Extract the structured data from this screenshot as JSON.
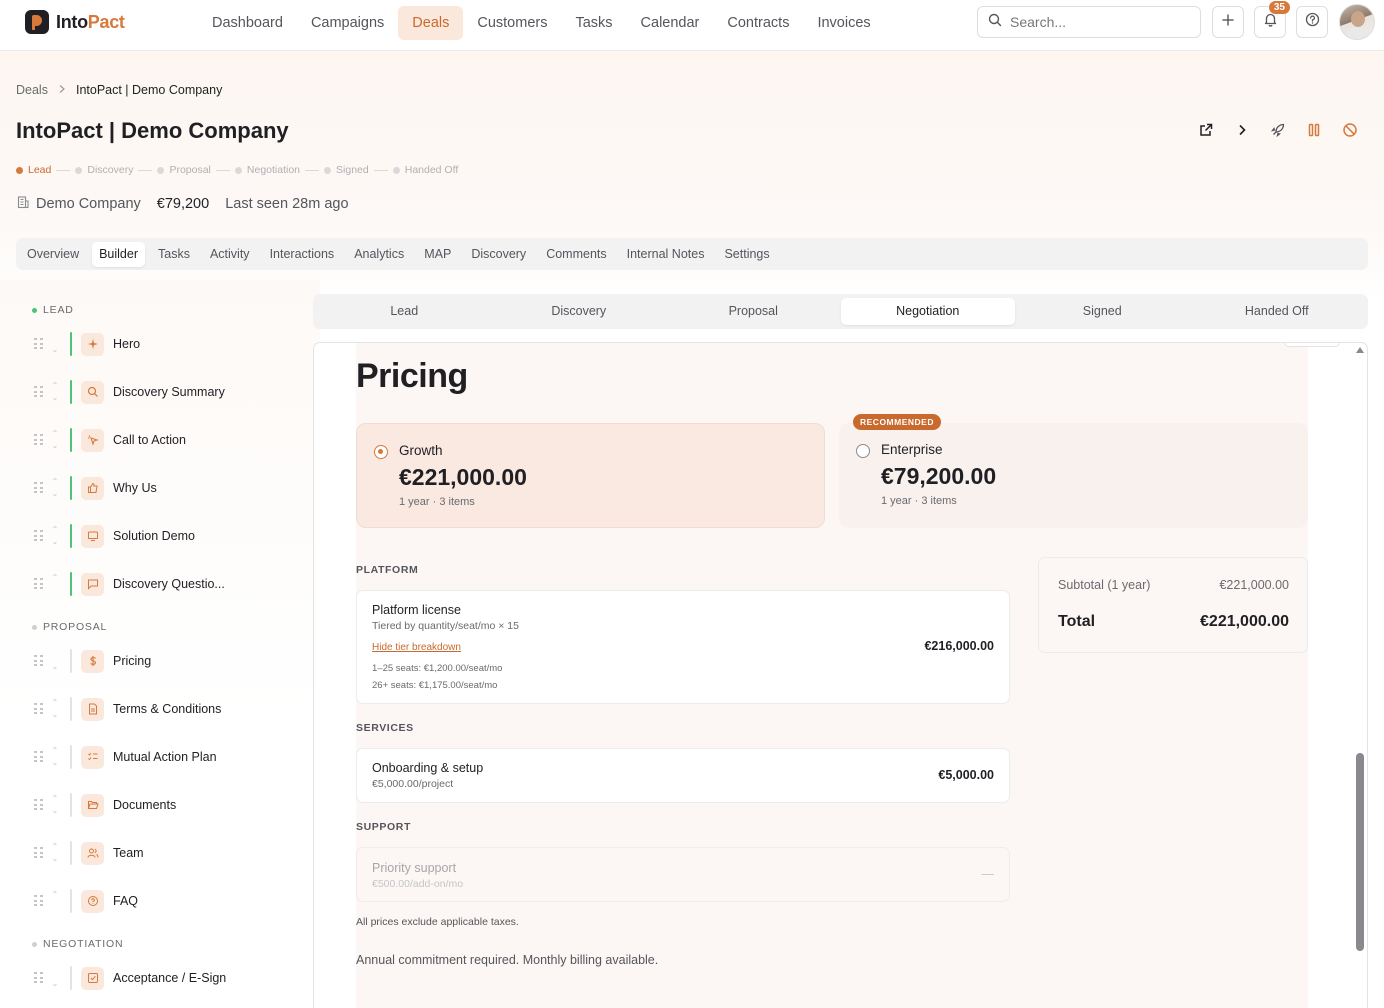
{
  "app": {
    "logo_main": "Into",
    "logo_accent": "Pact",
    "nav": [
      "Dashboard",
      "Campaigns",
      "Deals",
      "Customers",
      "Tasks",
      "Calendar",
      "Contracts",
      "Invoices"
    ],
    "active_nav": "Deals",
    "search_placeholder": "Search...",
    "notification_count": "35",
    "accent_color": "#d6793b"
  },
  "breadcrumb": [
    "Deals",
    "IntoPact | Demo Company"
  ],
  "deal": {
    "title": "IntoPact | Demo Company",
    "company": "Demo Company",
    "amount": "€79,200",
    "last_seen": "Last seen 28m ago",
    "stages": [
      "Lead",
      "Discovery",
      "Proposal",
      "Negotiation",
      "Signed",
      "Handed Off"
    ],
    "current_stage": "Lead"
  },
  "header_actions": [
    "external-link-icon",
    "chevron-right-icon",
    "rocket-icon",
    "pause-icon",
    "ban-icon"
  ],
  "tabs": [
    "Overview",
    "Builder",
    "Tasks",
    "Activity",
    "Interactions",
    "Analytics",
    "MAP",
    "Discovery",
    "Comments",
    "Internal Notes",
    "Settings"
  ],
  "active_tab": "Builder",
  "sidebar": {
    "sections": [
      {
        "label": "LEAD",
        "blocks": [
          {
            "label": "Hero",
            "icon": "sparkle-icon"
          },
          {
            "label": "Discovery Summary",
            "icon": "search-icon"
          },
          {
            "label": "Call to Action",
            "icon": "cursor-click-icon"
          },
          {
            "label": "Why Us",
            "icon": "thumbs-up-icon"
          },
          {
            "label": "Solution Demo",
            "icon": "monitor-icon"
          },
          {
            "label": "Discovery Questio...",
            "icon": "message-square-icon"
          }
        ]
      },
      {
        "label": "PROPOSAL",
        "blocks": [
          {
            "label": "Pricing",
            "icon": "dollar-icon"
          },
          {
            "label": "Terms & Conditions",
            "icon": "file-text-icon"
          },
          {
            "label": "Mutual Action Plan",
            "icon": "list-checks-icon"
          },
          {
            "label": "Documents",
            "icon": "folder-open-icon"
          },
          {
            "label": "Team",
            "icon": "users-icon"
          },
          {
            "label": "FAQ",
            "icon": "help-circle-icon"
          }
        ]
      },
      {
        "label": "NEGOTIATION",
        "blocks": [
          {
            "label": "Acceptance / E-Sign",
            "icon": "check-square-icon"
          }
        ]
      }
    ]
  },
  "stage_tabs": [
    "Lead",
    "Discovery",
    "Proposal",
    "Negotiation",
    "Signed",
    "Handed Off"
  ],
  "active_stage_tab": "Negotiation",
  "pricing": {
    "title": "Pricing",
    "plans": [
      {
        "name": "Growth",
        "price": "€221,000.00",
        "sub": "1 year · 3 items",
        "selected": true
      },
      {
        "name": "Enterprise",
        "price": "€79,200.00",
        "sub": "1 year · 3 items",
        "selected": false,
        "badge": "RECOMMENDED"
      }
    ],
    "groups": {
      "platform": {
        "label": "PLATFORM",
        "name": "Platform license",
        "desc": "Tiered by quantity/seat/mo × 15",
        "link": "Hide tier breakdown",
        "tier1": "1–25 seats: €1,200.00/seat/mo",
        "tier2": "26+ seats: €1,175.00/seat/mo",
        "price": "€216,000.00"
      },
      "services": {
        "label": "SERVICES",
        "name": "Onboarding & setup",
        "desc": "€5,000.00/project",
        "price": "€5,000.00"
      },
      "support": {
        "label": "SUPPORT",
        "name": "Priority support",
        "desc": "€500.00/add-on/mo",
        "price": "—"
      }
    },
    "subtotal_label": "Subtotal (1 year)",
    "subtotal_value": "€221,000.00",
    "total_label": "Total",
    "total_value": "€221,000.00",
    "note_small": "All prices exclude applicable taxes.",
    "note_large": "Annual commitment required. Monthly billing available."
  }
}
